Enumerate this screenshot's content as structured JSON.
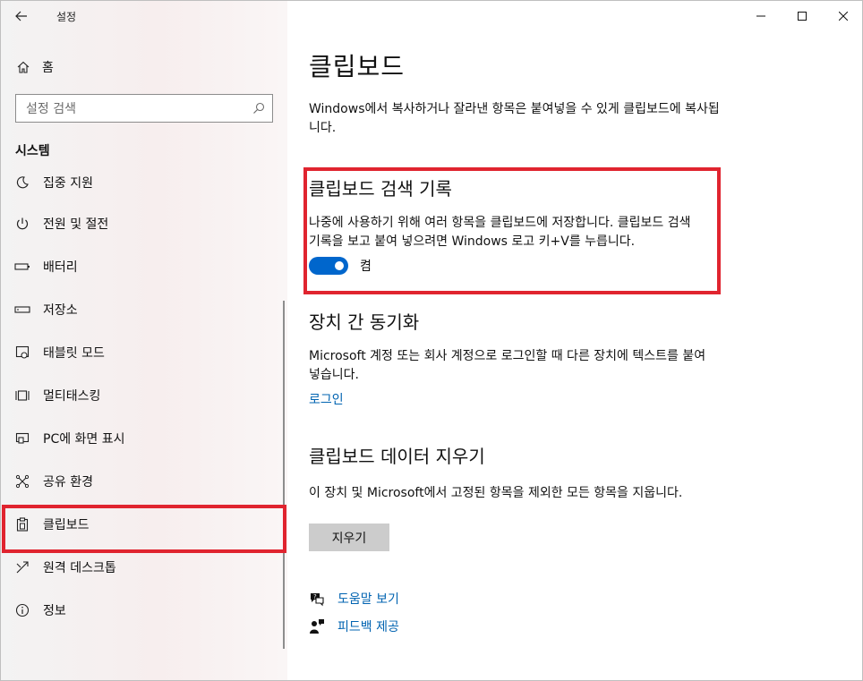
{
  "app": {
    "title": "설정"
  },
  "sidebar": {
    "home_label": "홈",
    "search_placeholder": "설정 검색",
    "section_title": "시스템",
    "items": [
      {
        "label": "집중 지원",
        "icon": "focus-assist-icon"
      },
      {
        "label": "전원 및 절전",
        "icon": "power-icon"
      },
      {
        "label": "배터리",
        "icon": "battery-icon"
      },
      {
        "label": "저장소",
        "icon": "storage-icon"
      },
      {
        "label": "태블릿 모드",
        "icon": "tablet-mode-icon"
      },
      {
        "label": "멀티태스킹",
        "icon": "multitasking-icon"
      },
      {
        "label": "PC에 화면 표시",
        "icon": "project-icon"
      },
      {
        "label": "공유 환경",
        "icon": "shared-experiences-icon"
      },
      {
        "label": "클립보드",
        "icon": "clipboard-icon",
        "selected": true
      },
      {
        "label": "원격 데스크톱",
        "icon": "remote-desktop-icon"
      },
      {
        "label": "정보",
        "icon": "info-icon"
      }
    ]
  },
  "main": {
    "title": "클립보드",
    "description": "Windows에서 복사하거나 잘라낸 항목은 붙여넣을 수 있게 클립보드에 복사됩니다.",
    "history": {
      "heading": "클립보드 검색 기록",
      "text": "나중에 사용하기 위해 여러 항목을 클립보드에 저장합니다. 클립보드 검색 기록을 보고 붙여 넣으려면 Windows 로고 키+V를 누릅니다.",
      "toggle_state": "on",
      "toggle_label": "켬"
    },
    "sync": {
      "heading": "장치 간 동기화",
      "text": "Microsoft 계정 또는 회사 계정으로 로그인할 때 다른 장치에 텍스트를 붙여넣습니다.",
      "link": "로그인"
    },
    "clear": {
      "heading": "클립보드 데이터 지우기",
      "text": "이 장치 및 Microsoft에서 고정된 항목을 제외한 모든 항목을 지웁니다.",
      "button": "지우기"
    },
    "help": {
      "get_help": "도움말 보기",
      "feedback": "피드백 제공"
    }
  },
  "colors": {
    "accent": "#0063b1",
    "toggle_on": "#0066cc",
    "highlight": "#e0242f"
  }
}
